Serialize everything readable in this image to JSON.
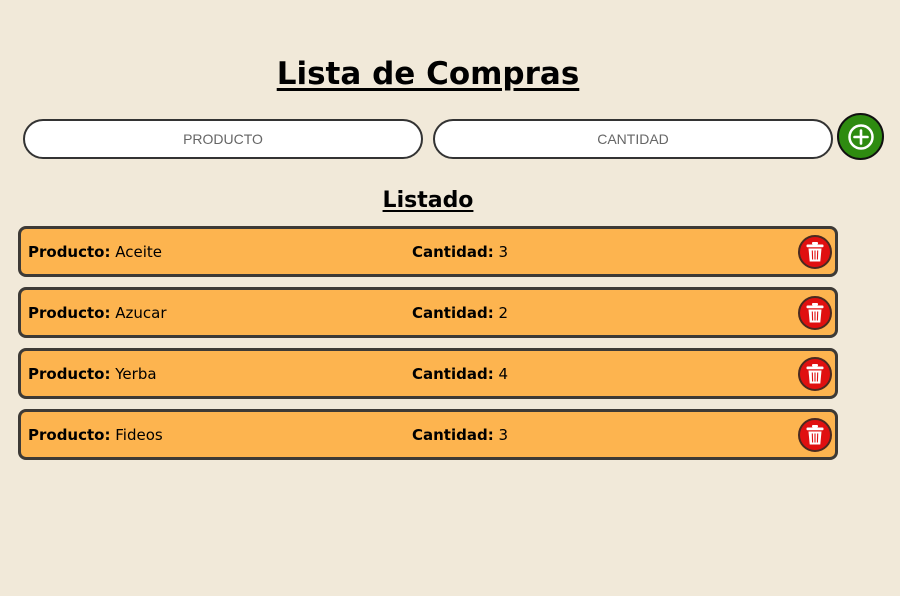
{
  "header": {
    "title": "Lista de Compras"
  },
  "form": {
    "producto_placeholder": "PRODUCTO",
    "cantidad_placeholder": "CANTIDAD",
    "add_icon": "plus-circle-icon"
  },
  "list": {
    "title": "Listado",
    "product_label": "Producto:",
    "quantity_label": "Cantidad:",
    "delete_icon": "trash-icon",
    "items": [
      {
        "producto": "Aceite",
        "cantidad": "3"
      },
      {
        "producto": "Azucar",
        "cantidad": "2"
      },
      {
        "producto": "Yerba",
        "cantidad": "4"
      },
      {
        "producto": "Fideos",
        "cantidad": "3"
      }
    ]
  },
  "colors": {
    "background": "#f1e9d9",
    "item_background": "#fdb44f",
    "add_button": "#2e8b10",
    "delete_button": "#e01010"
  }
}
